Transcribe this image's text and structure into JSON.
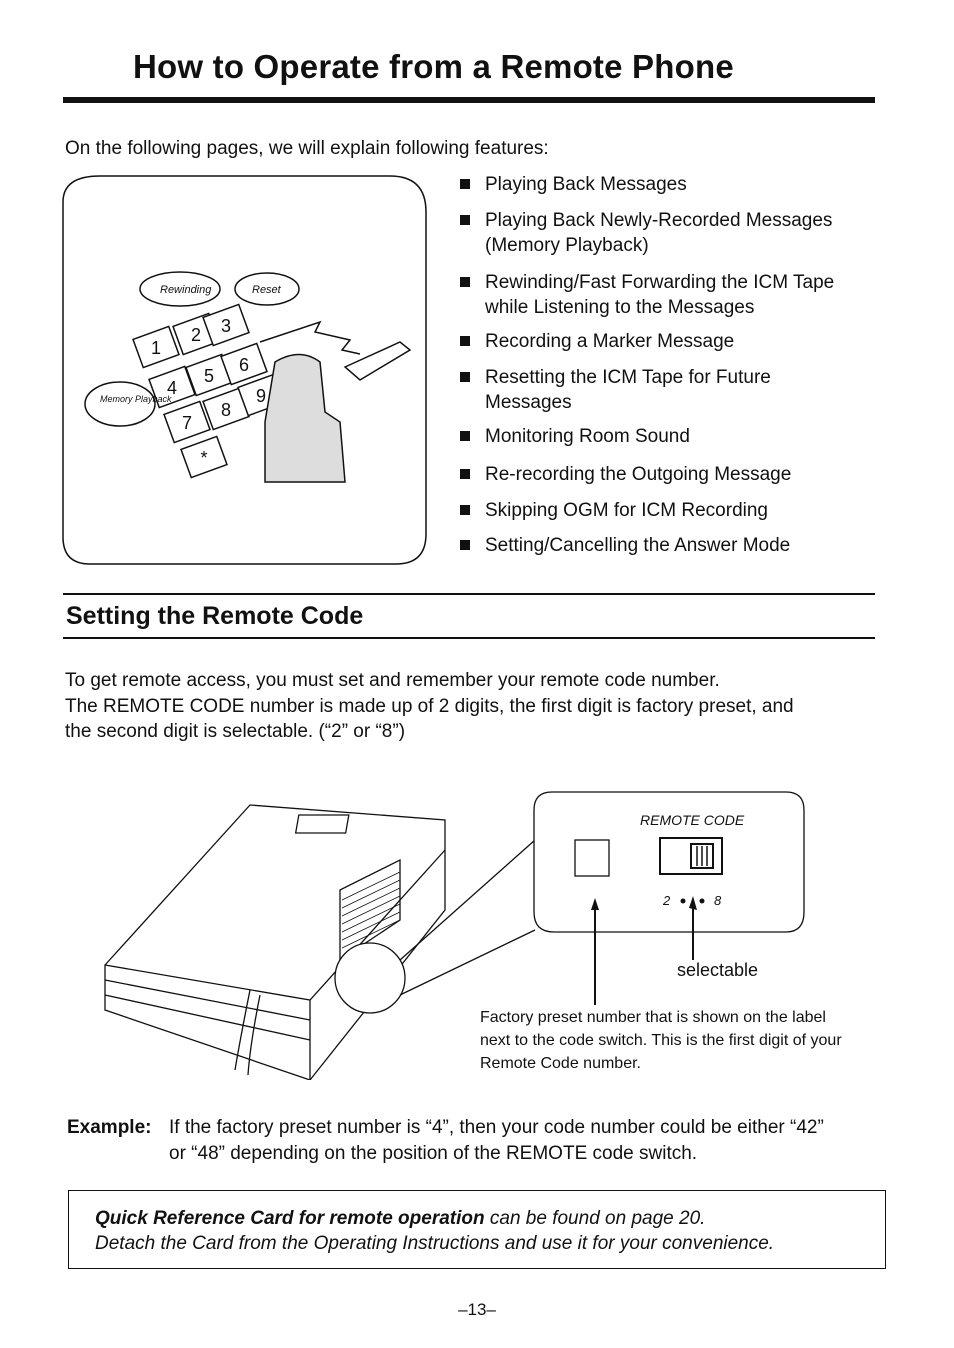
{
  "title": "How to Operate from a Remote Phone",
  "intro": "On the following pages, we will explain following features:",
  "illustration1": {
    "labels": [
      "Rewinding",
      "Reset",
      "Memory Playback"
    ],
    "keys": [
      "1",
      "2",
      "3",
      "4",
      "5",
      "6",
      "7",
      "8",
      "9",
      "*"
    ]
  },
  "features": [
    [
      "Playing Back Messages"
    ],
    [
      "Playing Back Newly-Recorded Messages",
      "(Memory Playback)"
    ],
    [
      "Rewinding/Fast Forwarding the ICM Tape",
      "while Listening to the Messages"
    ],
    [
      "Recording a Marker Message"
    ],
    [
      "Resetting the ICM Tape for Future",
      "Messages"
    ],
    [
      "Monitoring Room Sound"
    ],
    [
      "Re-recording the Outgoing Message"
    ],
    [
      "Skipping OGM for ICM Recording"
    ],
    [
      "Setting/Cancelling the Answer Mode"
    ]
  ],
  "section": {
    "heading": "Setting the Remote Code",
    "para": [
      "To get remote access, you must set and remember your remote code number.",
      "The REMOTE CODE number is made up of 2 digits, the first digit is factory preset, and",
      "the second digit is selectable. (“2” or “8”)"
    ]
  },
  "figure2": {
    "panel_label": "REMOTE CODE",
    "switch_digit_left": "2",
    "switch_digit_right": "8",
    "selectable": "selectable",
    "caption": [
      "Factory preset number that is shown on the label",
      "next to the code switch. This is the first digit of your",
      "Remote Code number."
    ]
  },
  "example": {
    "label": "Example:",
    "lines": [
      "If the factory preset number is “4”, then your code number could be either “42”",
      "or “48” depending on the position of the REMOTE code switch."
    ]
  },
  "note": {
    "bold": "Quick Reference Card for remote operation",
    "rest": " can be found on page 20.",
    "line2": "Detach the Card from the Operating Instructions and use it for your convenience."
  },
  "page_number": "–13–"
}
